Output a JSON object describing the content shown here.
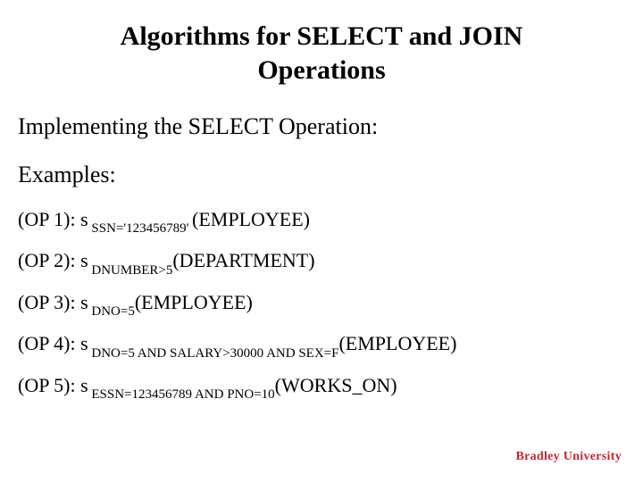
{
  "title": "Algorithms for SELECT and JOIN Operations",
  "subtitle": "Implementing the SELECT Operation:",
  "section_label": "Examples:",
  "sigma": "s",
  "ops": [
    {
      "label": "(OP 1): ",
      "sub": " SSN='123456789' ",
      "relation": "(EMPLOYEE)"
    },
    {
      "label": "(OP 2): ",
      "sub": " DNUMBER>5",
      "relation": "(DEPARTMENT)"
    },
    {
      "label": "(OP 3): ",
      "sub": " DNO=5",
      "relation": "(EMPLOYEE)"
    },
    {
      "label": "(OP 4): ",
      "sub": " DNO=5 AND SALARY>30000 AND SEX=F",
      "relation": "(EMPLOYEE)"
    },
    {
      "label": "(OP 5): ",
      "sub": " ESSN=123456789 AND PNO=10",
      "relation": "(WORKS_ON)"
    }
  ],
  "footer_brand": "Bradley University"
}
